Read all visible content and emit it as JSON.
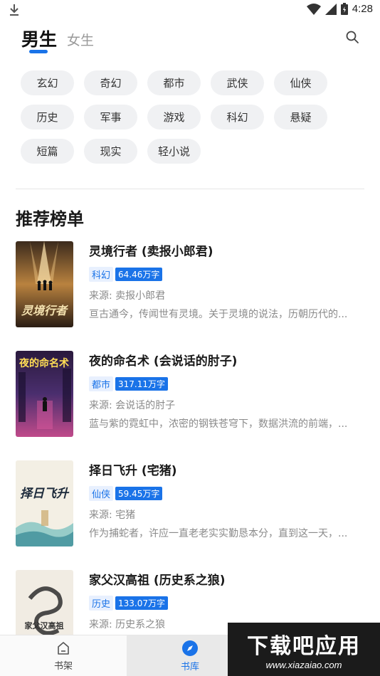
{
  "status_bar": {
    "time": "4:28"
  },
  "header": {
    "tabs": [
      "男生",
      "女生"
    ]
  },
  "categories": [
    "玄幻",
    "奇幻",
    "都市",
    "武侠",
    "仙侠",
    "历史",
    "军事",
    "游戏",
    "科幻",
    "悬疑",
    "短篇",
    "现实",
    "轻小说"
  ],
  "section_title": "推荐榜单",
  "books": [
    {
      "title": "灵境行者 (卖报小郎君)",
      "category": "科幻",
      "words": "64.46万字",
      "source": "来源: 卖报小郎君",
      "intro": "亘古通今，传闻世有灵境。关于灵境的说法，历朝历代的...",
      "cover_text": "灵境行者"
    },
    {
      "title": "夜的命名术 (会说话的肘子)",
      "category": "都市",
      "words": "317.11万字",
      "source": "来源: 会说话的肘子",
      "intro": "蓝与紫的霓虹中，浓密的钢铁苍穹下，数据洪流的前端，...",
      "cover_text": "夜的命名术"
    },
    {
      "title": "择日飞升 (宅猪)",
      "category": "仙侠",
      "words": "59.45万字",
      "source": "来源: 宅猪",
      "intro": "作为捕蛇者，许应一直老老实实勤恳本分，直到这一天，...",
      "cover_text": "择日飞升"
    },
    {
      "title": "家父汉高祖 (历史系之狼)",
      "category": "历史",
      "words": "133.07万字",
      "source": "来源: 历史系之狼",
      "intro": "",
      "cover_text": "家父汉高祖"
    }
  ],
  "bottom_nav": [
    {
      "label": "书架",
      "icon": "bookshelf-icon"
    },
    {
      "label": "书库",
      "icon": "compass-icon"
    }
  ],
  "watermark": {
    "main": "下载吧应用",
    "url": "www.xiazaiao.com"
  },
  "colors": {
    "accent": "#1a73e8"
  }
}
